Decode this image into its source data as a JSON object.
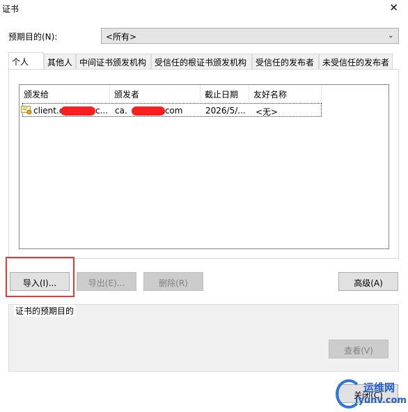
{
  "window": {
    "title": "证书",
    "close_glyph": "✕"
  },
  "purpose": {
    "label": "预期目的(N):",
    "selected": "<所有>"
  },
  "tabs": [
    {
      "label": "个人"
    },
    {
      "label": "其他人"
    },
    {
      "label": "中间证书颁发机构"
    },
    {
      "label": "受信任的根证书颁发机构"
    },
    {
      "label": "受信任的发布者"
    },
    {
      "label": "未受信任的发布者"
    }
  ],
  "list": {
    "columns": [
      "颁发给",
      "颁发者",
      "截止日期",
      "友好名称"
    ],
    "rows": [
      {
        "issued_to": "client.c",
        "issued_to_tail": "c...",
        "issued_by": "ca.",
        "issued_by_tail": ".com",
        "expires": "2026/5/...",
        "friendly_name": "<无>"
      }
    ]
  },
  "buttons": {
    "import": "导入(I)...",
    "export": "导出(E)...",
    "remove": "删除(R)",
    "advanced": "高级(A)",
    "view": "查看(V)",
    "close": "关闭(C)"
  },
  "group": {
    "label": "证书的预期目的"
  },
  "watermark": {
    "line1": "运维网",
    "line2": "iyunv.com"
  },
  "colors": {
    "highlight": "#e23b3b",
    "redaction": "#ff1f1f",
    "watermark": "#1f5fd0"
  }
}
